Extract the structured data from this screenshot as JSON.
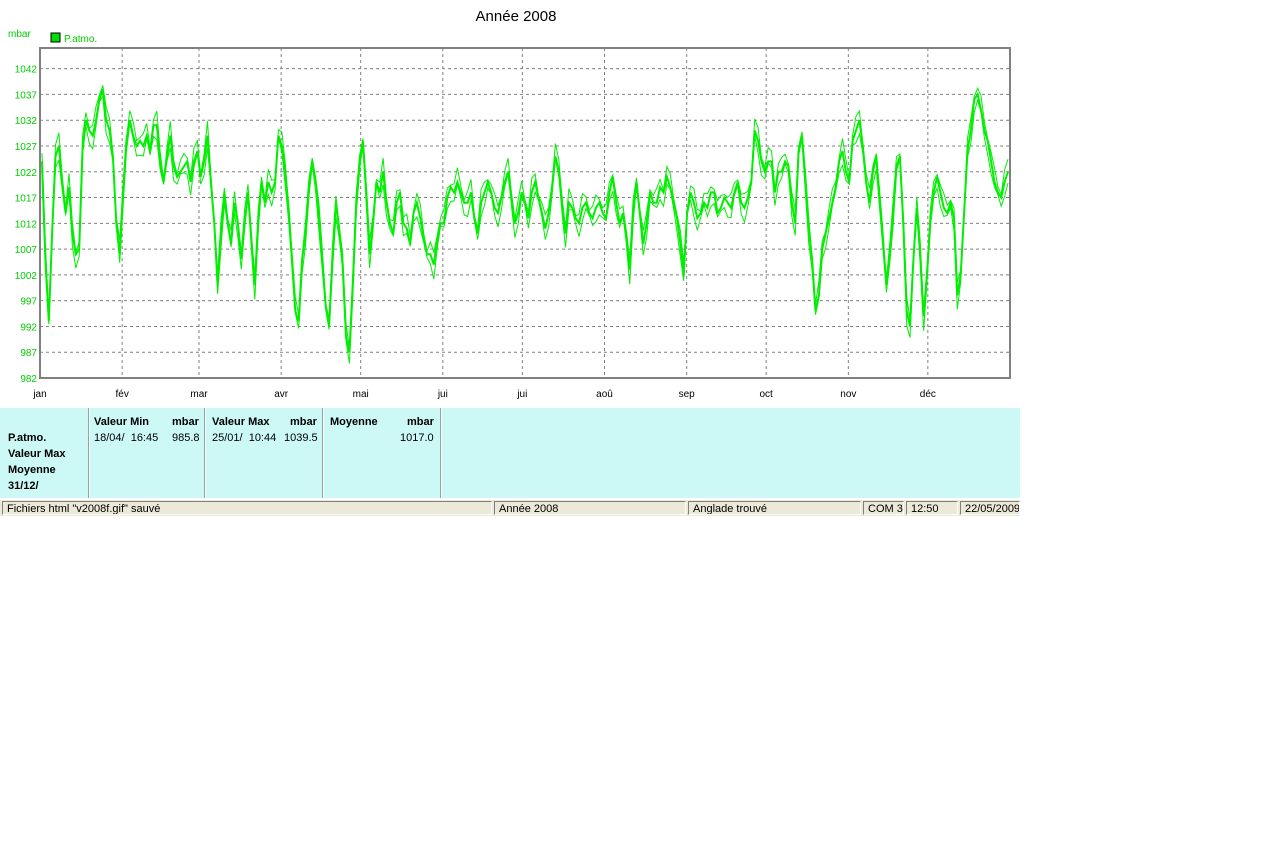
{
  "chart_data": {
    "type": "line",
    "title": "Année 2008",
    "ylabel": "mbar",
    "legend": "top-left",
    "grid": true,
    "ylim": [
      982,
      1046
    ],
    "yticks": [
      982,
      987,
      992,
      997,
      1002,
      1007,
      1012,
      1017,
      1022,
      1027,
      1032,
      1037,
      1042
    ],
    "months": [
      "jan",
      "fév",
      "mar",
      "avr",
      "mai",
      "jui",
      "jui",
      "aoû",
      "sep",
      "oct",
      "nov",
      "déc"
    ],
    "series_color": "#00ee00",
    "series": [
      {
        "name": "P.atmo.",
        "values": [
          1024,
          1005,
          993,
          1010,
          1025,
          1027,
          1020,
          1014,
          1019,
          1010,
          1006,
          1007,
          1026,
          1032,
          1030,
          1029,
          1032,
          1036,
          1038,
          1032,
          1030,
          1025,
          1012,
          1006,
          1018,
          1028,
          1032,
          1029,
          1027,
          1028,
          1027,
          1029,
          1026,
          1031,
          1031,
          1024,
          1020,
          1025,
          1029,
          1023,
          1021,
          1022,
          1023,
          1024,
          1020,
          1024,
          1026,
          1021,
          1024,
          1029,
          1020,
          1012,
          1000,
          1010,
          1018,
          1012,
          1008,
          1016,
          1012,
          1005,
          1012,
          1018,
          1009,
          1000,
          1012,
          1020,
          1016,
          1020,
          1018,
          1020,
          1029,
          1027,
          1022,
          1015,
          1005,
          995,
          993,
          1005,
          1010,
          1018,
          1024,
          1020,
          1013,
          1005,
          996,
          992,
          1005,
          1016,
          1011,
          1004,
          990,
          987,
          1000,
          1015,
          1023,
          1028,
          1018,
          1006,
          1012,
          1020,
          1018,
          1022,
          1016,
          1012,
          1010,
          1016,
          1018,
          1012,
          1011,
          1008,
          1014,
          1016,
          1013,
          1009,
          1006,
          1006,
          1004,
          1009,
          1012,
          1012,
          1017,
          1019,
          1018,
          1020,
          1018,
          1016,
          1016,
          1018,
          1013,
          1010,
          1016,
          1018,
          1020,
          1018,
          1015,
          1014,
          1017,
          1020,
          1022,
          1017,
          1012,
          1014,
          1018,
          1016,
          1013,
          1018,
          1020,
          1017,
          1014,
          1011,
          1014,
          1019,
          1025,
          1022,
          1016,
          1010,
          1016,
          1015,
          1013,
          1012,
          1015,
          1016,
          1014,
          1013,
          1015,
          1016,
          1014,
          1013,
          1018,
          1021,
          1016,
          1012,
          1014,
          1010,
          1003,
          1014,
          1020,
          1014,
          1008,
          1012,
          1018,
          1016,
          1016,
          1019,
          1018,
          1021,
          1019,
          1016,
          1013,
          1008,
          1002,
          1014,
          1018,
          1016,
          1013,
          1014,
          1016,
          1015,
          1018,
          1018,
          1014,
          1015,
          1017,
          1016,
          1015,
          1018,
          1020,
          1016,
          1015,
          1017,
          1020,
          1030,
          1028,
          1024,
          1022,
          1024,
          1024,
          1018,
          1022,
          1022,
          1024,
          1023,
          1016,
          1012,
          1026,
          1029,
          1020,
          1011,
          1005,
          995,
          998,
          1007,
          1010,
          1013,
          1016,
          1019,
          1024,
          1026,
          1022,
          1020,
          1028,
          1030,
          1032,
          1027,
          1020,
          1016,
          1022,
          1025,
          1016,
          1008,
          1000,
          1007,
          1014,
          1023,
          1025,
          1012,
          995,
          992,
          1005,
          1015,
          1006,
          994,
          1002,
          1012,
          1018,
          1021,
          1018,
          1015,
          1014,
          1016,
          1013,
          998,
          1002,
          1014,
          1026,
          1030,
          1036,
          1037,
          1034,
          1030,
          1028,
          1024,
          1020,
          1018,
          1017,
          1020,
          1022
        ]
      }
    ]
  },
  "stats": {
    "row_labels": [
      "P.atmo.",
      "Valeur Max",
      "Moyenne",
      "31/12/"
    ],
    "min": {
      "header": "Valeur Min",
      "unit": "mbar",
      "date": "18/04/  16:45",
      "value": "985.8"
    },
    "max": {
      "header": "Valeur Max",
      "unit": "mbar",
      "date": "25/01/  10:44",
      "value": "1039.5"
    },
    "avg": {
      "header": "Moyenne",
      "unit": "mbar",
      "value": "1017.0"
    }
  },
  "statusbar": {
    "message": "Fichiers html  \"v2008f.gif\"  sauvé",
    "period": "Année 2008",
    "device": "Anglade trouvé",
    "port": "COM 3",
    "time": "12:50",
    "date": "22/05/2009"
  }
}
